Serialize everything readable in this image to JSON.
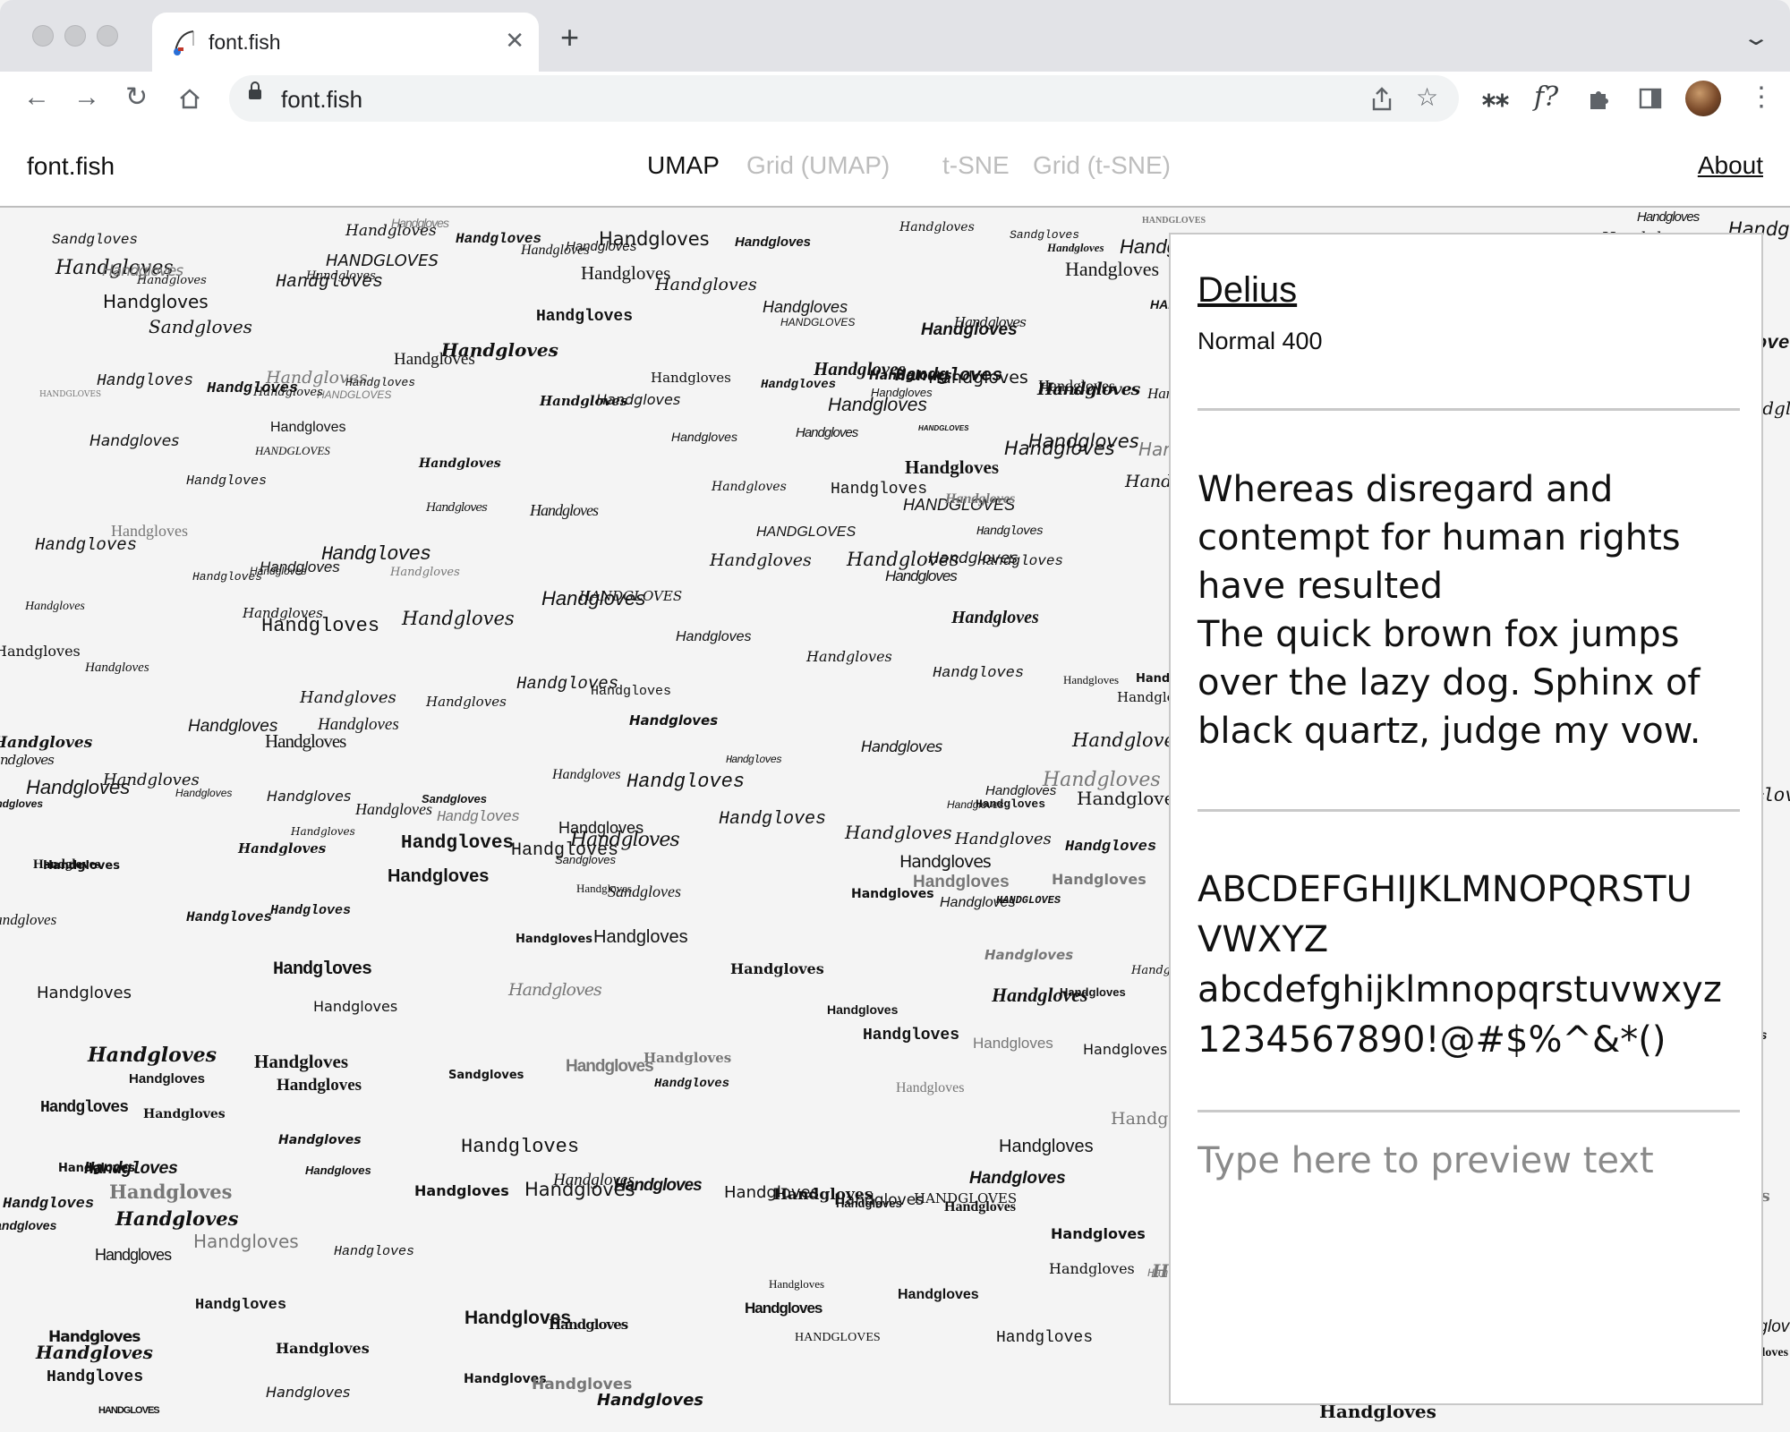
{
  "browser": {
    "tab_title": "font.fish",
    "url": "font.fish",
    "new_tab_symbol": "+",
    "close_symbol": "✕",
    "icons": [
      "back-icon",
      "forward-icon",
      "reload-icon",
      "home-icon",
      "share-icon",
      "star-icon",
      "extension-asterisk-icon",
      "extension-font-icon",
      "puzzle-icon",
      "sidepanel-icon",
      "avatar",
      "more-icon"
    ],
    "extension_font_label": "f?",
    "extension_asterisk_label": "⁎⁎"
  },
  "site": {
    "brand": "font.fish",
    "nav": [
      {
        "label": "UMAP",
        "active": true
      },
      {
        "label": "Grid (UMAP)",
        "active": false
      },
      {
        "label": "t-SNE",
        "active": false
      },
      {
        "label": "Grid (t-SNE)",
        "active": false
      }
    ],
    "about": "About"
  },
  "map": {
    "sample_word": "Handgloves",
    "sample_word_caps": "HANDGLOVES",
    "sample_word_mixed": "Sandgloves"
  },
  "panel": {
    "font_name": "Delius",
    "font_style": "Normal 400",
    "sample_lines": [
      "Whereas disregard and",
      "contempt for human rights",
      "have resulted",
      "The quick brown fox jumps",
      "over the lazy dog. Sphinx of",
      "black quartz, judge my vow."
    ],
    "glyph_lines": [
      "ABCDEFGHIJKLMNOPQRSTU",
      "VWXYZ",
      "abcdefghijklmnopqrstuvwxyz",
      "1234567890!@#$%^&*()"
    ],
    "preview_placeholder": "Type here to preview text"
  }
}
